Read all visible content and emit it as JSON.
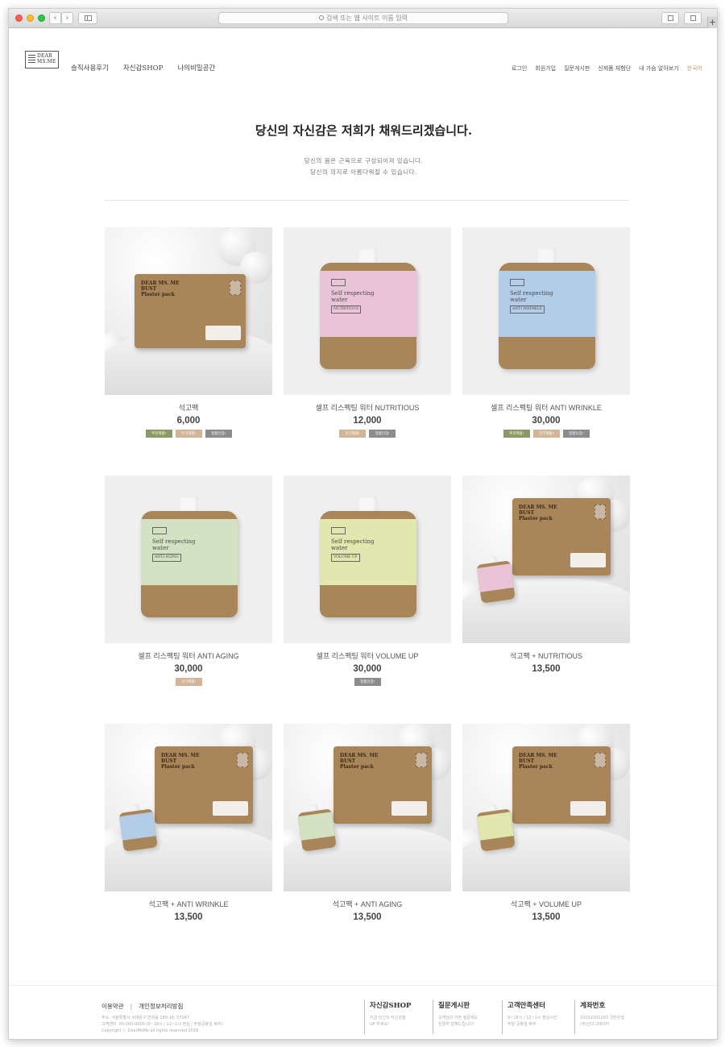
{
  "browser": {
    "url_placeholder": "검색 또는 웹 사이트 이름 입력",
    "back_glyph": "‹",
    "forward_glyph": "›",
    "newtab_glyph": "+"
  },
  "header": {
    "logo_line1": "DEAR",
    "logo_line2": "MS.ME",
    "main_nav": [
      "솔직사용후기",
      "자신감SHOP",
      "나의비밀공간"
    ],
    "util_nav": [
      "로그인",
      "회원가입",
      "질문게시판",
      "신제품 체험단",
      "내 가슴 알아보기",
      "한국어"
    ]
  },
  "hero": {
    "title": "당신의 자신감은 저희가 채워드리겠습니다.",
    "subtitle_line1": "당신의 몸은 근육으로 구성되어져 있습니다.",
    "subtitle_line2": "당신의 의지로 아름다워질 수 있습니다."
  },
  "products": [
    {
      "name": "석고팩",
      "price": "6,000",
      "badges": [
        "추천제품!",
        "인기제품!",
        "정품인증!"
      ]
    },
    {
      "name": "셀프 리스펙팅 워터 NUTRITIOUS",
      "price": "12,000",
      "badges": [
        "인기제품!",
        "정품인증!"
      ]
    },
    {
      "name": "셀프 리스펙팅 워터 ANTI WRINKLE",
      "price": "30,000",
      "badges": [
        "추천제품!",
        "인기제품!",
        "정품인증!"
      ]
    },
    {
      "name": "셀프 리스펙팅 워터 ANTI AGING",
      "price": "30,000",
      "badges": [
        "인기제품!"
      ]
    },
    {
      "name": "셀프 리스펙팅 워터 VOLUME UP",
      "price": "30,000",
      "badges": [
        "정품인증!"
      ]
    },
    {
      "name": "석고팩 + NUTRITIOUS",
      "price": "13,500",
      "badges": []
    },
    {
      "name": "석고팩 + ANTI WRINKLE",
      "price": "13,500",
      "badges": []
    },
    {
      "name": "석고팩 + ANTI AGING",
      "price": "13,500",
      "badges": []
    },
    {
      "name": "석고팩 + VOLUME UP",
      "price": "13,500",
      "badges": []
    }
  ],
  "packaging": {
    "plaster_title": [
      "DEAR MS. ME",
      "BUST",
      "Plaster pack"
    ],
    "pouch_title": [
      "Self respecting",
      "water"
    ],
    "pouch_labels": [
      "NUTRITIOUS",
      "ANTI WRINKLE",
      "ANTI AGING",
      "VOLUME UP"
    ],
    "pouch_colors": [
      "#e9c4d6",
      "#b3cde9",
      "#d3e2c2",
      "#e1e7ae"
    ]
  },
  "badge_colors": {
    "추천제품!": "#8a9a62",
    "인기제품!": "#d4b496",
    "정품인증!": "#8c8c8c"
  },
  "footer": {
    "terms": "이용약관",
    "privacy": "개인정보처리방침",
    "separator": "|",
    "address": "주소. 서울특별시 서대문구 연희동 189-16, 07047",
    "contact": "고객센터. 00-000-0000 (9~18시 / 12~1시 점심 / 주말공휴일 휴무)",
    "copyright": "Copyright ⓒ DearMsMe all rights reserved 2018",
    "columns": [
      {
        "heading": "자신감SHOP",
        "line1": "지금 당신의 자신감을",
        "line2": "UP 하세요!"
      },
      {
        "heading": "질문게시판",
        "line1": "고객님의 어떤 질문에도",
        "line2": "친절히 답해드립니다!"
      },
      {
        "heading": "고객만족센터",
        "line1": "9~18시 / 12~1시 점심시간",
        "line2": "주말 공휴일 휴무"
      },
      {
        "heading": "계좌번호",
        "line1": "10102301203 국민은행",
        "line2": "(주)인더그레이터"
      }
    ]
  }
}
